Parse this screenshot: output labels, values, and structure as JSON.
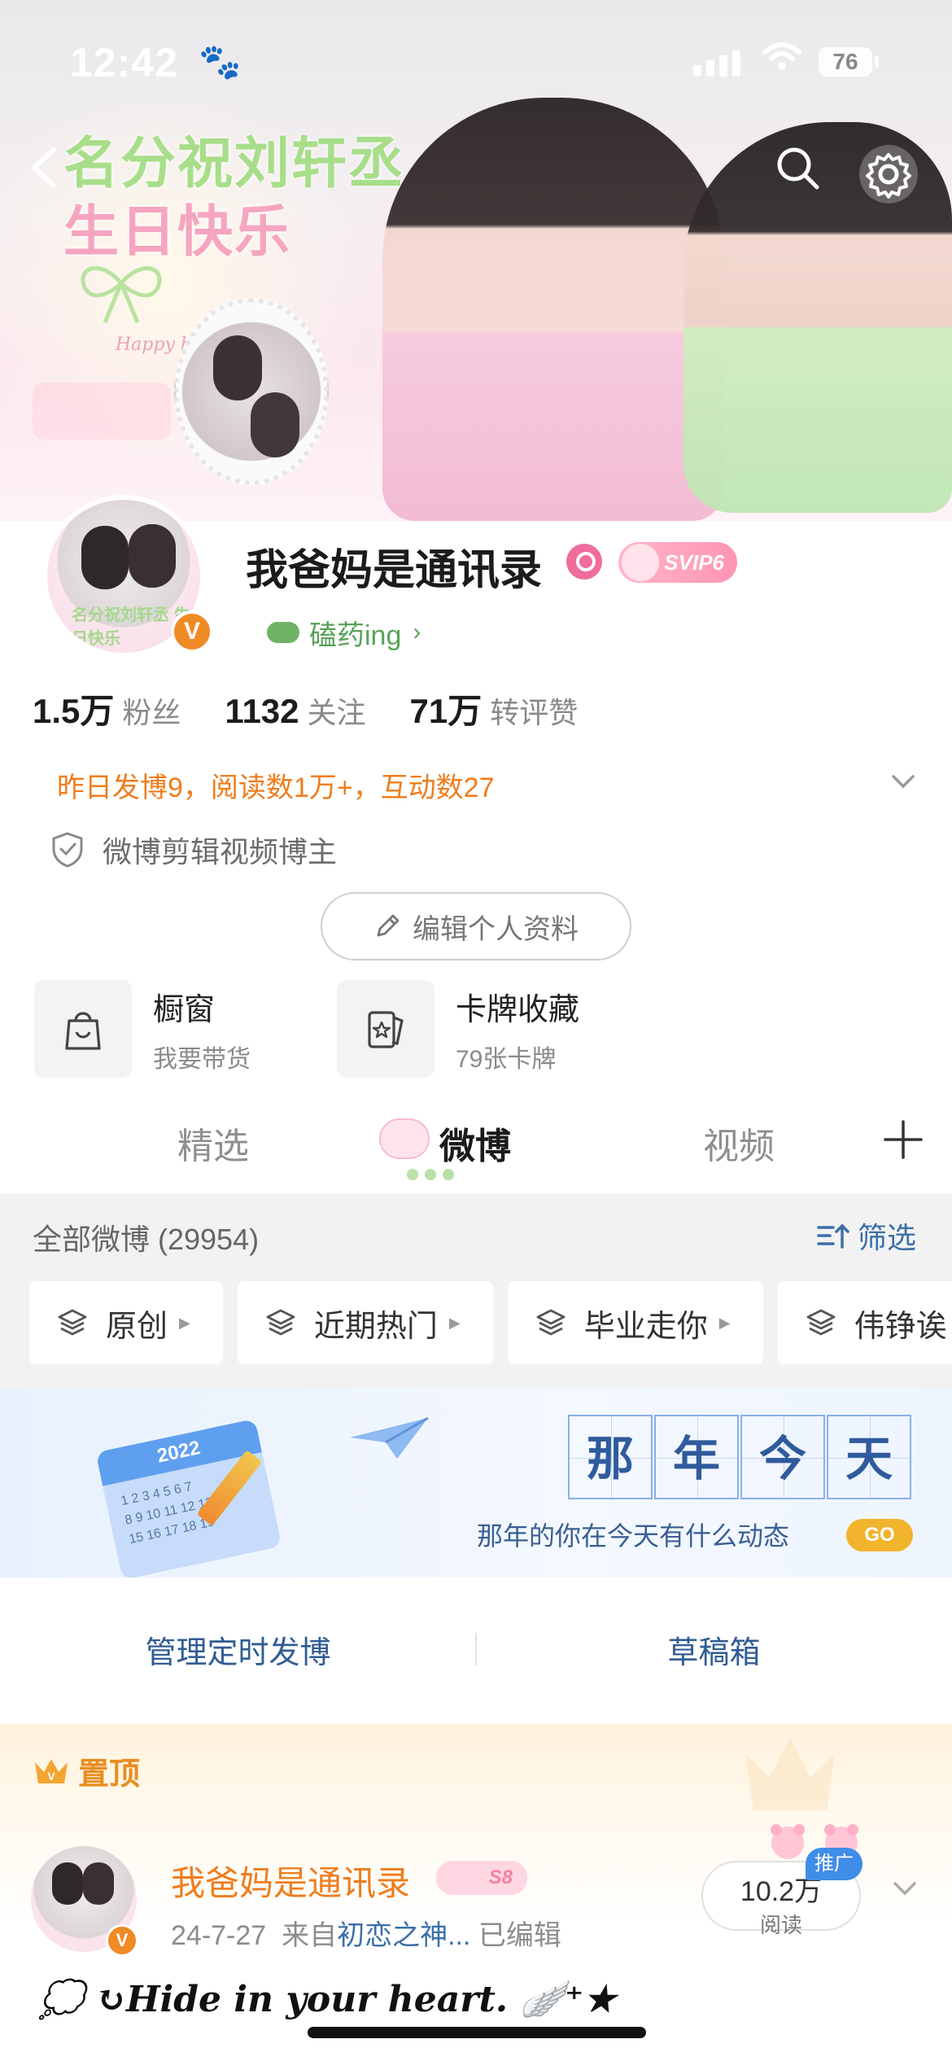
{
  "status_bar": {
    "time": "12:42",
    "battery": "76"
  },
  "banner": {
    "title_line1": "名分祝刘轩丞",
    "title_line2": "生日快乐",
    "greeting": "Happy birthday"
  },
  "profile": {
    "avatar_caption": "名分祝刘轩丞 生日快乐",
    "verified_badge": "V",
    "username": "我爸妈是通讯录",
    "vip_badge": "SVIP6",
    "status": "磕药ing",
    "status_chevron": "›",
    "stats": [
      {
        "num": "1.5万",
        "label": "粉丝"
      },
      {
        "num": "1132",
        "label": "关注"
      },
      {
        "num": "71万",
        "label": "转评赞"
      }
    ],
    "daily_summary": "昨日发博9，阅读数1万+，互动数27",
    "certification": "微博剪辑视频博主",
    "edit_button": "编辑个人资料"
  },
  "shortcuts": [
    {
      "title": "橱窗",
      "subtitle": "我要带货"
    },
    {
      "title": "卡牌收藏",
      "subtitle": "79张卡牌"
    }
  ],
  "tabs": [
    {
      "label": "精选"
    },
    {
      "label": "微博"
    },
    {
      "label": "视频"
    }
  ],
  "feed_header": {
    "all_label": "全部微博 (29954)",
    "filter_label": "筛选"
  },
  "chips": [
    "原创",
    "近期热门",
    "毕业走你",
    "伟铮诶"
  ],
  "memory_banner": {
    "year": "2022",
    "chars": [
      "那",
      "年",
      "今",
      "天"
    ],
    "subtitle": "那年的你在今天有什么动态",
    "go": "GO"
  },
  "manage": {
    "scheduled": "管理定时发博",
    "drafts": "草稿箱"
  },
  "pinned_post": {
    "pin_label": "置顶",
    "author": "我爸妈是通讯录",
    "author_badge": "S8",
    "date": "24-7-27",
    "source_prefix": "来自",
    "source": "初恋之神...",
    "edited": "已编辑",
    "reads_count": "10.2万",
    "reads_label": "阅读",
    "promo": "推广",
    "text": "💭 ↻Hide in your heart. 🪽⁺★"
  },
  "colors": {
    "accent_orange": "#ef7d1d",
    "link_blue": "#3b6fa8",
    "tab_active": "#1b1b1b"
  }
}
